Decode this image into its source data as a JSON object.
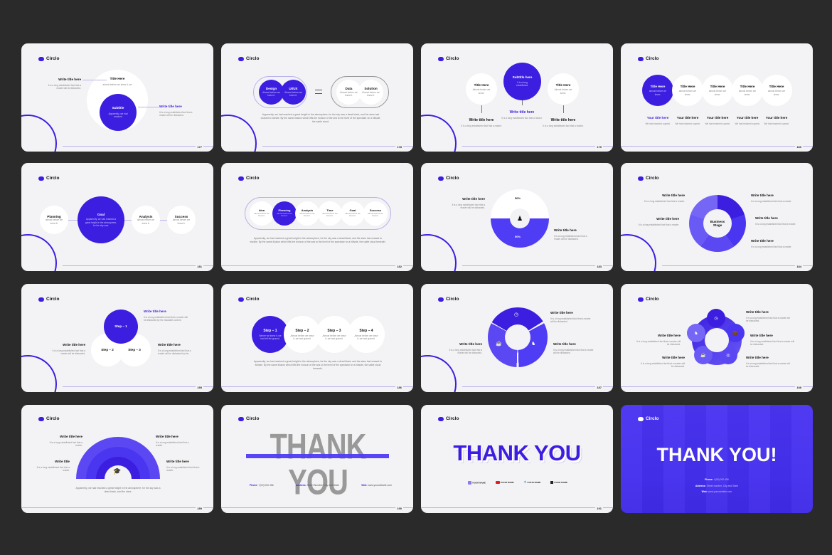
{
  "brand": {
    "name": "Circlo",
    "accent": "#3b1ee0"
  },
  "slides": [
    {
      "page": "177",
      "left": {
        "title": "Write title here",
        "text": "It is a long established fact that a reader will be distracted."
      },
      "outer": {
        "title": "Title Here",
        "text": "almost before we knew it, we"
      },
      "inner": {
        "title": "Subtitle",
        "text": "Apparently, we had reached"
      },
      "right": {
        "title": "Write title here",
        "text": "It is a long established fact that a reader will be distracted."
      }
    },
    {
      "page": "178",
      "items": [
        {
          "title": "Design",
          "text": "Almost before we knew it."
        },
        {
          "title": "UI/UX",
          "text": "Almost before we knew it."
        },
        {
          "title": "Data",
          "text": "Almost before we knew it."
        },
        {
          "title": "Solution",
          "text": "Almost before we knew it."
        }
      ],
      "paragraph": "Apparently, we had reached a great height in the atmosphere, for the sky was a dead black, and the stars had ceased to twinkle. By the same illusion which lifts the horizon of the sea to the level of the spectator on a hillside, the sable cloud."
    },
    {
      "page": "179",
      "circles": [
        {
          "title": "Title Here",
          "text": "Almost before we knew."
        },
        {
          "title": "Subtitle here",
          "text": "It is a long established."
        },
        {
          "title": "Title Here",
          "text": "Almost before we knew."
        }
      ],
      "labels": [
        {
          "title": "Write title here",
          "text": "It is a long established fact that a reader."
        },
        {
          "title": "Write title here",
          "text": "It is a long established fact that a reader."
        },
        {
          "title": "Write title here",
          "text": "It is a long established fact that a reader."
        }
      ]
    },
    {
      "page": "180",
      "circles": [
        {
          "title": "Title Here",
          "text": "almost before we knew."
        },
        {
          "title": "Title Here",
          "text": "almost before we knew."
        },
        {
          "title": "Title Here",
          "text": "almost before we knew."
        },
        {
          "title": "Title Here",
          "text": "almost before we knew."
        },
        {
          "title": "Title Here",
          "text": "almost before we knew."
        }
      ],
      "labels": [
        {
          "title": "Your title here",
          "text": "We had reached a great."
        },
        {
          "title": "Your title here",
          "text": "We had reached a great."
        },
        {
          "title": "Your title here",
          "text": "We had reached a great."
        },
        {
          "title": "Your title here",
          "text": "We had reached a great."
        },
        {
          "title": "Your title here",
          "text": "We had reached a great."
        }
      ]
    },
    {
      "page": "181",
      "items": [
        {
          "title": "Planning",
          "text": "almost before we knew it."
        },
        {
          "title": "Goal",
          "text": "Apparently, we had reached a great height in the atmosphere, for the sky was."
        },
        {
          "title": "Analysis",
          "text": "almost before we knew it."
        },
        {
          "title": "Success",
          "text": "almost before we knew it."
        }
      ]
    },
    {
      "page": "182",
      "items": [
        {
          "title": "Idea",
          "text": "almost before we knew it."
        },
        {
          "title": "Planning",
          "text": "almost before we knew it."
        },
        {
          "title": "Analysis",
          "text": "almost before we knew it."
        },
        {
          "title": "Time",
          "text": "almost before we knew it."
        },
        {
          "title": "Goal",
          "text": "almost before we knew it."
        },
        {
          "title": "Success",
          "text": "almost before we knew it."
        }
      ],
      "paragraph": "Apparently, we had reached a great height in the atmosphere, for the sky was a dead black, and the stars had ceased to twinkle. By the same illusion which lifts the horizon of the sea to the level of the spectator on a hillside, the sable cloud beneath."
    },
    {
      "page": "183",
      "top_pct": "50%",
      "bottom_pct": "50%",
      "left": {
        "title": "Write title here",
        "text": "It is a long established fact that a reader will be distracted."
      },
      "right": {
        "title": "Write title here",
        "text": "It is a long established fact that a reader will be distracted."
      }
    },
    {
      "page": "184",
      "center": "Business Stage",
      "labels": [
        {
          "title": "Write title here",
          "text": "It is a long established fact that a reader."
        },
        {
          "title": "Write title here",
          "text": "It is a long established fact that a reader."
        },
        {
          "title": "Write title here",
          "text": "It is a long established fact that a reader."
        },
        {
          "title": "Write title here",
          "text": "It is a long established fact that a reader."
        },
        {
          "title": "Write title here",
          "text": "It is a long established fact that a reader."
        }
      ]
    },
    {
      "page": "185",
      "steps": [
        "Step – 1",
        "Step – 2",
        "Step – 3"
      ],
      "labels": [
        {
          "title": "Write title here",
          "text": "It is a long established fact that a reader will be distracted by the readable content."
        },
        {
          "title": "Write title here",
          "text": "It is a long established fact that a reader will be distracted."
        },
        {
          "title": "Write title here",
          "text": "It is a long established fact that a reader will be distracted by the."
        }
      ]
    },
    {
      "page": "186",
      "steps": [
        {
          "title": "Step – 1",
          "text": "Before we knew it, we had left the ground."
        },
        {
          "title": "Step – 2",
          "text": "Almost before we knew it, we had ground."
        },
        {
          "title": "Step – 3",
          "text": "Almost before we knew it, we had ground."
        },
        {
          "title": "Step – 4",
          "text": "Almost before we knew it, we had ground."
        }
      ],
      "paragraph": "Apparently, we had reached a great height in the atmosphere, for the sky was a dead black, and the stars had ceased to twinkle. By the same illusion which lifts the horizon of the sea to the level of the spectator on a hillside, the sable cloud beneath."
    },
    {
      "page": "187",
      "labels": [
        {
          "title": "Write title here",
          "text": "It is a long established fact that a reader will be distracted."
        },
        {
          "title": "Write title here",
          "text": "It is a long established fact that a reader will be distracted."
        },
        {
          "title": "Write title here",
          "text": "It is a long established fact that a reader will be distracted."
        }
      ]
    },
    {
      "page": "188",
      "labels": [
        {
          "title": "Write title here",
          "text": "It is a long established fact that a reader will be distracted."
        },
        {
          "title": "Write title here",
          "text": "It is a long established fact that a reader will be distracted."
        },
        {
          "title": "Write title here",
          "text": "It is a long established fact that a reader will be distracted."
        },
        {
          "title": "Write title here",
          "text": "It is a long established fact that a reader will be distracted."
        },
        {
          "title": "Write title here",
          "text": "It is a long established fact that a reader will be distracted."
        }
      ]
    },
    {
      "page": "189",
      "labels": [
        {
          "title": "Write title here",
          "text": "It is a long established fact that a reader."
        },
        {
          "title": "Write title here",
          "text": "It is a long established fact that a reader."
        },
        {
          "title": "Write title",
          "text": "It is a long established fact that a reader."
        },
        {
          "title": "Write title here",
          "text": "It is a long established fact that a reader."
        }
      ],
      "paragraph": "Apparently, we had reached a great height in the atmosphere, for the sky was a dead black, and the stars."
    },
    {
      "page": "190",
      "heading": "THANK YOU",
      "contacts": [
        {
          "label": "Phone:",
          "value": "+(00) 000 456"
        },
        {
          "label": "Address:",
          "value": "Street Number, City and State"
        },
        {
          "label": "Web:",
          "value": "www.yourwebsite.com"
        }
      ]
    },
    {
      "page": "191",
      "heading": "THANK YOU",
      "socials": [
        {
          "icon": "instagram-icon",
          "label": "/YOUR NAME",
          "color": "#8a7cf0"
        },
        {
          "icon": "youtube-icon",
          "label": "/YOUR NAME",
          "color": "#e01e1e"
        },
        {
          "icon": "twitter-icon",
          "label": "/YOUR NAME",
          "color": "#1da1f2"
        },
        {
          "icon": "facebook-icon",
          "label": "/YOUR NAME",
          "color": "#222222"
        }
      ]
    },
    {
      "page": "192",
      "heading": "THANK YOU!",
      "contacts": [
        {
          "label": "Phone:",
          "value": "+(00) 000 456"
        },
        {
          "label": "Address:",
          "value": "Street number, City and State"
        },
        {
          "label": "Web:",
          "value": "www.yourwebsite.com"
        }
      ]
    }
  ]
}
